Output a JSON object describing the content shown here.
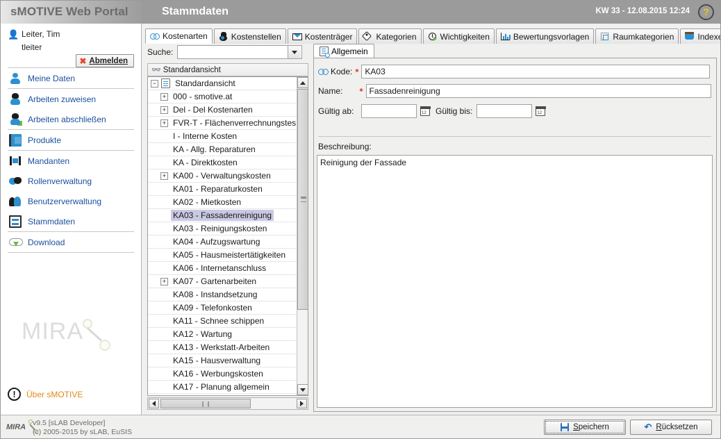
{
  "header": {
    "app_title": "sMOTIVE Web Portal",
    "page_title": "Stammdaten",
    "datetime": "KW 33 - 12.08.2015 12:24",
    "help_label": "?"
  },
  "sidebar": {
    "user_name": "Leiter, Tim",
    "user_login": "tleiter",
    "logout_label": "Abmelden",
    "items": [
      {
        "label": "Meine Daten",
        "icon": "person-icon"
      },
      {
        "label": "Arbeiten zuweisen",
        "icon": "worker-assign-icon"
      },
      {
        "label": "Arbeiten abschließen",
        "icon": "worker-complete-icon"
      },
      {
        "label": "Produkte",
        "icon": "book-icon"
      },
      {
        "label": "Mandanten",
        "icon": "arrows-icon"
      },
      {
        "label": "Rollenverwaltung",
        "icon": "masks-icon"
      },
      {
        "label": "Benutzerverwaltung",
        "icon": "users-icon"
      },
      {
        "label": "Stammdaten",
        "icon": "data-icon"
      },
      {
        "label": "Download",
        "icon": "cloud-download-icon"
      }
    ],
    "watermark": "MIRA",
    "about_label": "Über sMOTIVE"
  },
  "tabs": [
    {
      "label": "Kostenarten",
      "icon": "cost-type-icon",
      "active": true
    },
    {
      "label": "Kostenstellen",
      "icon": "cost-center-icon",
      "active": false
    },
    {
      "label": "Kostenträger",
      "icon": "cost-unit-icon",
      "active": false
    },
    {
      "label": "Kategorien",
      "icon": "tag-icon",
      "active": false
    },
    {
      "label": "Wichtigkeiten",
      "icon": "clock-icon",
      "active": false
    },
    {
      "label": "Bewertungsvorlagen",
      "icon": "bar-chart-icon",
      "active": false
    },
    {
      "label": "Raumkategorien",
      "icon": "room-icon",
      "active": false
    },
    {
      "label": "Indexe",
      "icon": "index-icon",
      "active": false
    },
    {
      "label": "",
      "icon": "sqrt-icon",
      "active": false
    }
  ],
  "tree_panel": {
    "search_label": "Suche:",
    "search_value": "",
    "search_placeholder": "",
    "header_label": "Standardansicht",
    "rows": [
      {
        "label": "Standardansicht",
        "indent": 0,
        "expander": "minus",
        "doc": true,
        "selected": false
      },
      {
        "label": "000 - smotive.at",
        "indent": 1,
        "expander": "plus",
        "doc": false,
        "selected": false
      },
      {
        "label": "Del - Del Kostenarten",
        "indent": 1,
        "expander": "plus",
        "doc": false,
        "selected": false
      },
      {
        "label": "FVR-T - Flächenverrechnungstes",
        "indent": 1,
        "expander": "plus",
        "doc": false,
        "selected": false
      },
      {
        "label": "I - Interne Kosten",
        "indent": 1,
        "expander": "none",
        "doc": false,
        "selected": false
      },
      {
        "label": "KA - Allg. Reparaturen",
        "indent": 1,
        "expander": "none",
        "doc": false,
        "selected": false
      },
      {
        "label": "KA - Direktkosten",
        "indent": 1,
        "expander": "none",
        "doc": false,
        "selected": false
      },
      {
        "label": "KA00 - Verwaltungskosten",
        "indent": 1,
        "expander": "plus",
        "doc": false,
        "selected": false
      },
      {
        "label": "KA01 - Reparaturkosten",
        "indent": 1,
        "expander": "none",
        "doc": false,
        "selected": false
      },
      {
        "label": "KA02 - Mietkosten",
        "indent": 1,
        "expander": "none",
        "doc": false,
        "selected": false
      },
      {
        "label": "KA03 - Fassadenreinigung",
        "indent": 1,
        "expander": "none",
        "doc": false,
        "selected": true
      },
      {
        "label": "KA03 - Reinigungskosten",
        "indent": 1,
        "expander": "none",
        "doc": false,
        "selected": false
      },
      {
        "label": "KA04 - Aufzugswartung",
        "indent": 1,
        "expander": "none",
        "doc": false,
        "selected": false
      },
      {
        "label": "KA05 - Hausmeistertätigkeiten",
        "indent": 1,
        "expander": "none",
        "doc": false,
        "selected": false
      },
      {
        "label": "KA06 - Internetanschluss",
        "indent": 1,
        "expander": "none",
        "doc": false,
        "selected": false
      },
      {
        "label": "KA07 - Gartenarbeiten",
        "indent": 1,
        "expander": "plus",
        "doc": false,
        "selected": false
      },
      {
        "label": "KA08 - Instandsetzung",
        "indent": 1,
        "expander": "none",
        "doc": false,
        "selected": false
      },
      {
        "label": "KA09 - Telefonkosten",
        "indent": 1,
        "expander": "none",
        "doc": false,
        "selected": false
      },
      {
        "label": "KA11 - Schnee schippen",
        "indent": 1,
        "expander": "none",
        "doc": false,
        "selected": false
      },
      {
        "label": "KA12 - Wartung",
        "indent": 1,
        "expander": "none",
        "doc": false,
        "selected": false
      },
      {
        "label": "KA13 - Werkstatt-Arbeiten",
        "indent": 1,
        "expander": "none",
        "doc": false,
        "selected": false
      },
      {
        "label": "KA15 - Hausverwaltung",
        "indent": 1,
        "expander": "none",
        "doc": false,
        "selected": false
      },
      {
        "label": "KA16 - Werbungskosten",
        "indent": 1,
        "expander": "none",
        "doc": false,
        "selected": false
      },
      {
        "label": "KA17 - Planung allgemein",
        "indent": 1,
        "expander": "none",
        "doc": false,
        "selected": false
      }
    ]
  },
  "form": {
    "tab_label": "Allgemein",
    "kode_label": "Kode:",
    "kode_value": "KA03",
    "name_label": "Name:",
    "name_value": "Fassadenreinigung",
    "valid_from_label": "Gültig ab:",
    "valid_from_value": "",
    "valid_to_label": "Gültig bis:",
    "valid_to_value": "",
    "description_label": "Beschreibung:",
    "description_value": "Reinigung der Fassade",
    "required_marker": "*"
  },
  "footer": {
    "version": "v9.5 [sLAB Developer]",
    "copyright": "(c) 2005-2015 by sLAB, EuSIS",
    "logo": "MIRA",
    "save_label": "Speichern",
    "reset_label": "Rücksetzen"
  },
  "colors": {
    "accent_blue": "#2d8fd0",
    "link_blue": "#1a4f9c",
    "selection": "#c9c9e4",
    "header_gray": "#9b9b9b",
    "about_orange": "#e08a19"
  }
}
